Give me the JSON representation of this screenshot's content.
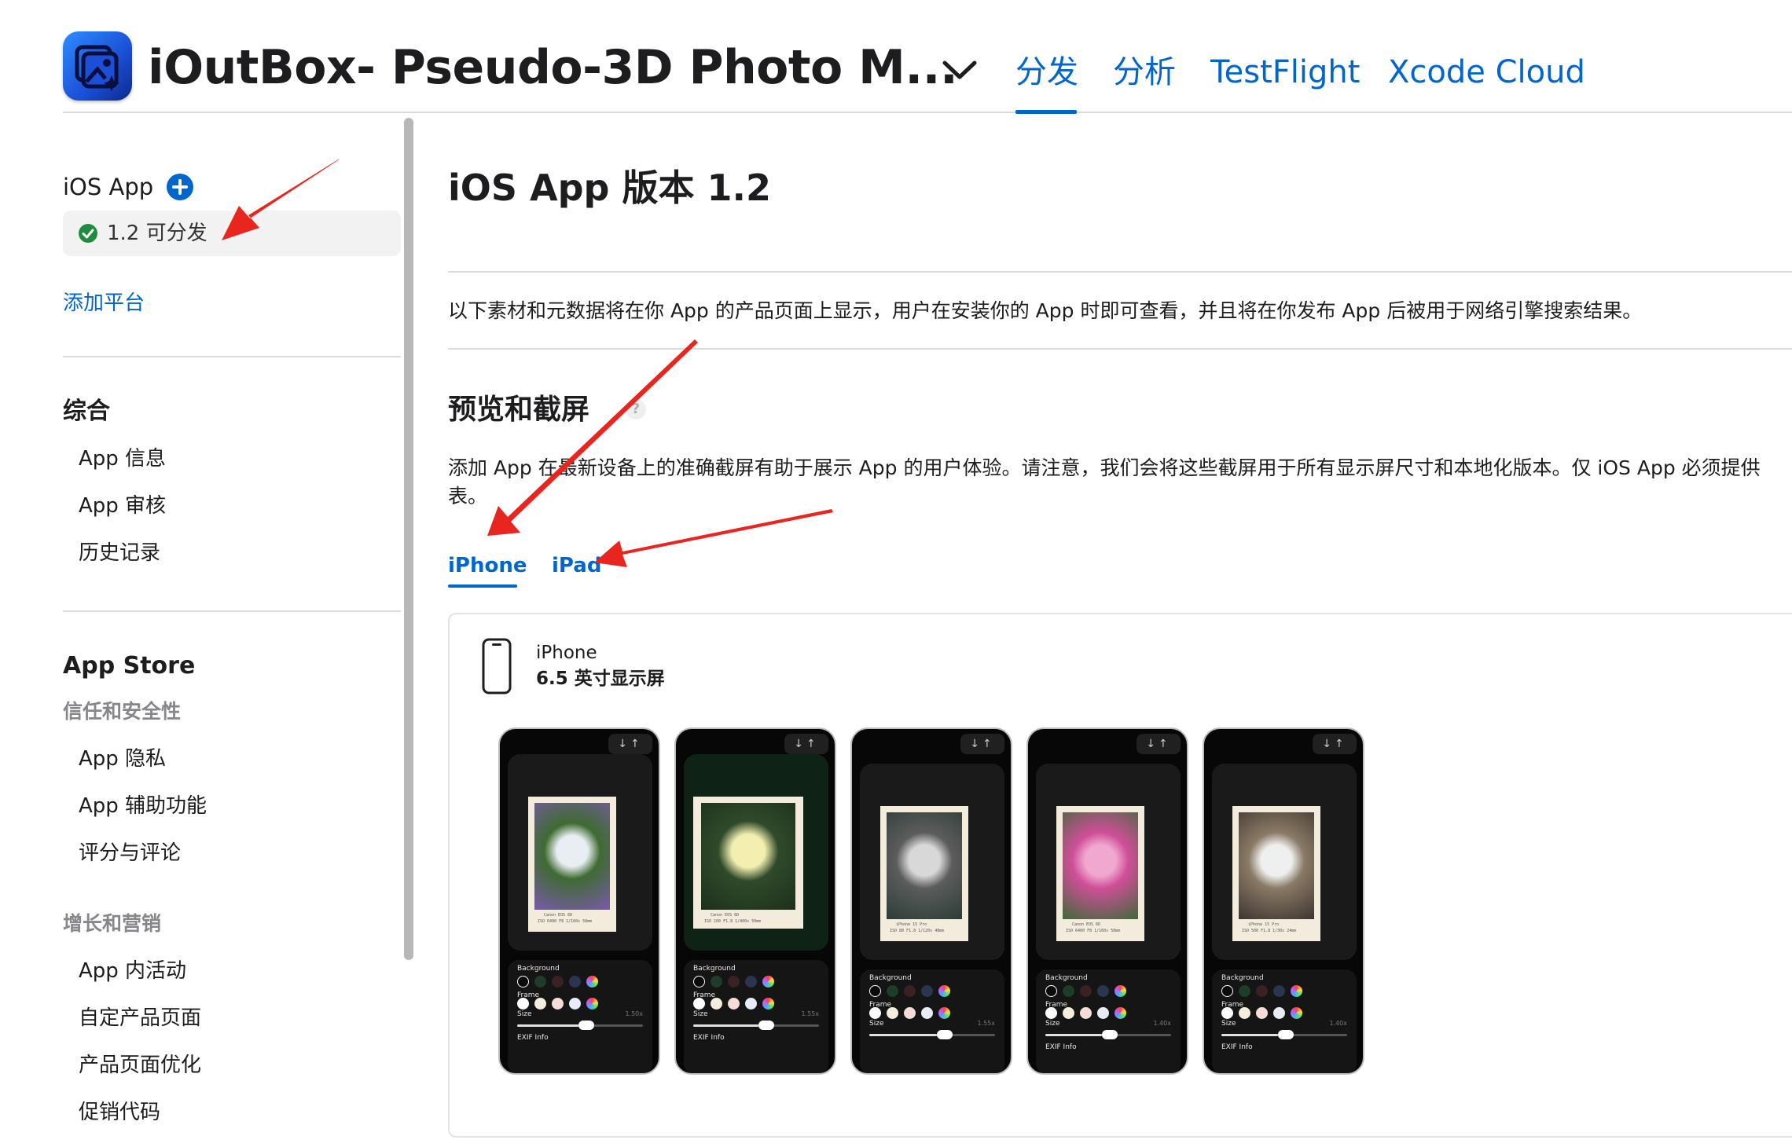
{
  "header": {
    "app_title": "iOutBox- Pseudo-3D Photo M...",
    "tabs": [
      {
        "label": "分发",
        "active": true
      },
      {
        "label": "分析"
      },
      {
        "label": "TestFlight"
      },
      {
        "label": "Xcode Cloud"
      }
    ]
  },
  "sidebar": {
    "platform": "iOS App",
    "version_label": "1.2 可分发",
    "add_platform": "添加平台",
    "general": {
      "title": "综合",
      "items": [
        "App 信息",
        "App 审核",
        "历史记录"
      ]
    },
    "app_store": {
      "title": "App Store",
      "trust": {
        "title": "信任和安全性",
        "items": [
          "App 隐私",
          "App 辅助功能",
          "评分与评论"
        ]
      },
      "growth": {
        "title": "增长和营销",
        "items": [
          "App 内活动",
          "自定产品页面",
          "产品页面优化",
          "促销代码"
        ]
      }
    }
  },
  "main": {
    "title": "iOS App 版本 1.2",
    "intro": "以下素材和元数据将在你 App 的产品页面上显示，用户在安装你的 App 时即可查看，并且将在你发布 App 后被用于网络引擎搜索结果。",
    "preview": {
      "title": "预览和截屏",
      "help": "?",
      "desc_line1": "添加 App 在最新设备上的准确截屏有助于展示 App 的用户体验。请注意，我们会将这些截屏用于所有显示屏尺寸和本地化版本。仅 iOS App 必须提供",
      "desc_line2": "表。",
      "device_tabs": [
        "iPhone",
        "iPad"
      ],
      "device_name": "iPhone",
      "display_size": "6.5 英寸显示屏"
    },
    "screenshots": [
      {
        "subject": "iris-flower",
        "colors": [
          "#e9eef2",
          "#3f6b32",
          "#7a5aa8"
        ],
        "caption": "Canon EOS 6D",
        "exif": "ISO 6400  F8  1/160s  50mm",
        "size_value": "1.50x",
        "slider": 0.52,
        "controls": [
          "Background",
          "Frame",
          "Size",
          "EXIF Info"
        ]
      },
      {
        "subject": "daffodil",
        "colors": [
          "#f3efb0",
          "#2f4a2a",
          "#1d2f1c"
        ],
        "caption": "Canon EOS 6D",
        "exif": "ISO 100  F1.8  1/400s  50mm",
        "size_value": "1.55x",
        "slider": 0.55,
        "controls": [
          "Background",
          "Frame",
          "Size",
          "EXIF Info"
        ]
      },
      {
        "subject": "winged-figure",
        "colors": [
          "#d8d8d8",
          "#5c5c5c",
          "#2c3c36"
        ],
        "caption": "iPhone 15 Pro",
        "exif": "ISO 80  F1.8  1/120s  48mm",
        "size_value": "1.55x",
        "slider": 0.57,
        "controls": [
          "Background",
          "Frame",
          "Size"
        ]
      },
      {
        "subject": "pink-peony",
        "colors": [
          "#f0a8d0",
          "#cf4f98",
          "#3e6a3a"
        ],
        "caption": "Canon EOS 6D",
        "exif": "ISO 6400  F8  1/160s  50mm",
        "size_value": "1.40x",
        "slider": 0.48,
        "controls": [
          "Background",
          "Frame",
          "Size",
          "EXIF Info"
        ]
      },
      {
        "subject": "cat",
        "colors": [
          "#efefef",
          "#8a7a66",
          "#3c3530"
        ],
        "caption": "iPhone 15 Pro",
        "exif": "ISO 500  F1.8  1/30s  24mm",
        "size_value": "1.40x",
        "slider": 0.48,
        "controls": [
          "Background",
          "Frame",
          "Size",
          "EXIF Info"
        ]
      }
    ],
    "background_swatches": [
      "#0a0a0a",
      "#1f3b2c",
      "#3a2222",
      "#2a3550",
      "rainbow"
    ],
    "frame_swatches": [
      "#ffffff",
      "#f4eedc",
      "#f5dcd8",
      "#e8ecf6",
      "rainbow"
    ]
  },
  "colors": {
    "accent": "#0066cc",
    "annotation": "#e8261f"
  }
}
